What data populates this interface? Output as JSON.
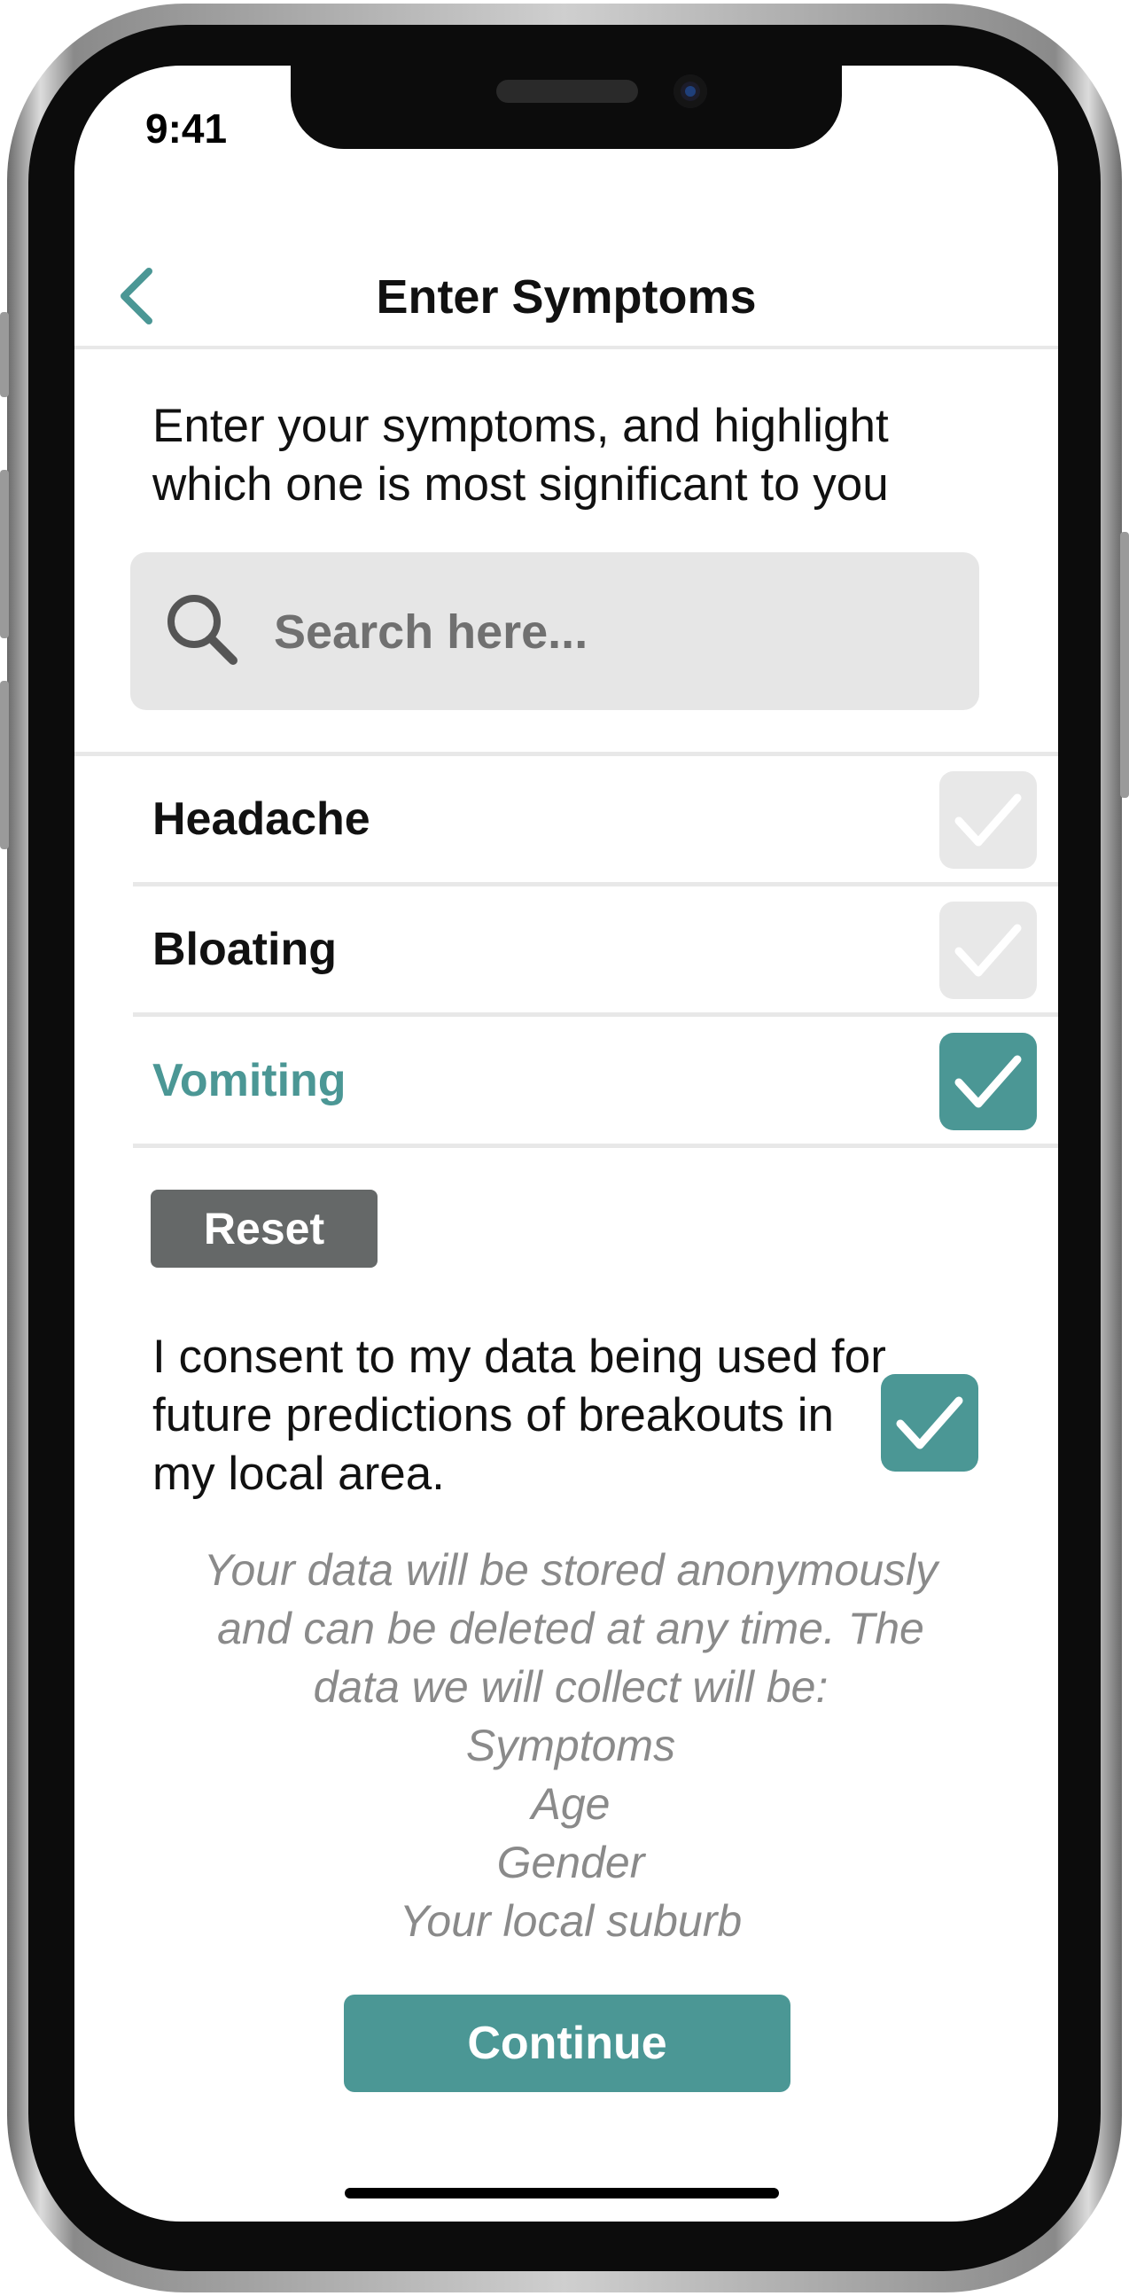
{
  "status_bar": {
    "time": "9:41"
  },
  "header": {
    "title": "Enter Symptoms",
    "back_icon": "chevron-left-icon"
  },
  "intro": {
    "text": "Enter your symptoms, and highlight which one is most significant to you"
  },
  "search": {
    "placeholder": "Search here...",
    "value": "",
    "icon": "search-icon"
  },
  "symptoms": [
    {
      "label": "Headache",
      "checked": false,
      "highlighted": false
    },
    {
      "label": "Bloating",
      "checked": false,
      "highlighted": false
    },
    {
      "label": "Vomiting",
      "checked": true,
      "highlighted": true
    }
  ],
  "reset": {
    "label": "Reset"
  },
  "consent": {
    "text": "I consent to my data being used for future predictions of breakouts in my local area.",
    "checked": true
  },
  "privacy": {
    "lines": [
      "Your data will be stored anonymously",
      "and can be deleted at any time. The",
      "data we will collect will be:",
      "Symptoms",
      "Age",
      "Gender",
      "Your local suburb"
    ]
  },
  "continue": {
    "label": "Continue"
  },
  "colors": {
    "accent": "#4b9795",
    "unchecked": "#e8e8e8",
    "reset": "#656868",
    "muted_text": "#8a8a8a"
  }
}
